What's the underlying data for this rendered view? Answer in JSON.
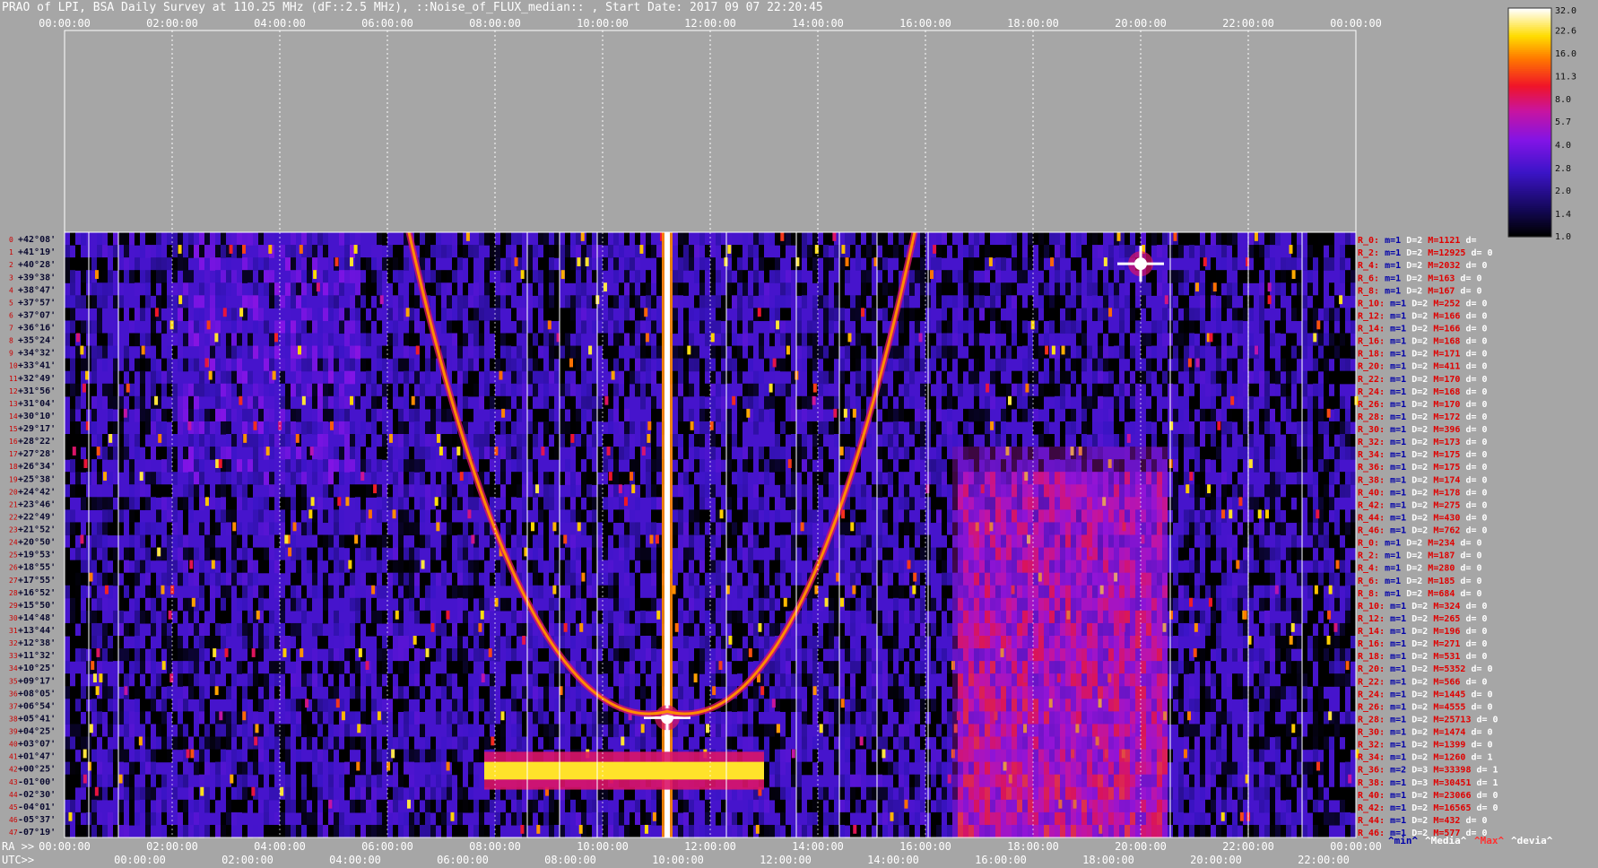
{
  "chart_data": {
    "type": "heatmap",
    "title": "PRAO of LPI, BSA Daily Survey at 110.25 MHz (dF::2.5 MHz), ::Noise_of_FLUX_median:: , Start Date: 2017 09 07 22:20:45",
    "top_axis_ticks": [
      "00:00:00",
      "02:00:00",
      "04:00:00",
      "06:00:00",
      "08:00:00",
      "10:00:00",
      "12:00:00",
      "14:00:00",
      "16:00:00",
      "18:00:00",
      "20:00:00",
      "22:00:00",
      "00:00:00"
    ],
    "ra_axis_label": "RA >>",
    "ra_ticks": [
      "00:00:00",
      "02:00:00",
      "04:00:00",
      "06:00:00",
      "08:00:00",
      "10:00:00",
      "12:00:00",
      "14:00:00",
      "16:00:00",
      "18:00:00",
      "20:00:00",
      "22:00:00",
      "00:00:00"
    ],
    "utc_axis_label": "UTC>>",
    "utc_ticks": [
      "00:00:00",
      "02:00:00",
      "04:00:00",
      "06:00:00",
      "08:00:00",
      "10:00:00",
      "12:00:00",
      "14:00:00",
      "16:00:00",
      "18:00:00",
      "20:00:00",
      "22:00:00"
    ],
    "colorbar": {
      "ticks": [
        "32.0",
        "22.6",
        "16.0",
        "11.3",
        "8.0",
        "5.7",
        "4.0",
        "2.8",
        "2.0",
        "1.4",
        "1.0"
      ],
      "scale": "log",
      "range": [
        1.0,
        32.0
      ]
    },
    "declinations": [
      "+42°08'",
      "+41°19'",
      "+40°28'",
      "+39°38'",
      "+38°47'",
      "+37°57'",
      "+37°07'",
      "+36°16'",
      "+35°24'",
      "+34°32'",
      "+33°41'",
      "+32°49'",
      "+31°56'",
      "+31°04'",
      "+30°10'",
      "+29°17'",
      "+28°22'",
      "+27°28'",
      "+26°34'",
      "+25°38'",
      "+24°42'",
      "+23°46'",
      "+22°49'",
      "+21°52'",
      "+20°50'",
      "+19°53'",
      "+18°55'",
      "+17°55'",
      "+16°52'",
      "+15°50'",
      "+14°48'",
      "+13°44'",
      "+12°38'",
      "+11°32'",
      "+10°25'",
      "+09°17'",
      "+08°05'",
      "+06°54'",
      "+05°41'",
      "+04°25'",
      "+03°07'",
      "+01°47'",
      "+00°25'",
      "-01°00'",
      "-02°30'",
      "-04°01'",
      "-05°37'",
      "-07°19'"
    ],
    "row_stats": [
      {
        "r": "R_0:",
        "m": "m=1",
        "d": "D=2",
        "mx": "M=1121",
        "dv": "d="
      },
      {
        "r": "R_2:",
        "m": "m=1",
        "d": "D=2",
        "mx": "M=12925",
        "dv": "d= 0"
      },
      {
        "r": "R_4:",
        "m": "m=1",
        "d": "D=2",
        "mx": "M=2032",
        "dv": "d= 0"
      },
      {
        "r": "R_6:",
        "m": "m=1",
        "d": "D=2",
        "mx": "M=163",
        "dv": "d= 0"
      },
      {
        "r": "R_8:",
        "m": "m=1",
        "d": "D=2",
        "mx": "M=167",
        "dv": "d= 0"
      },
      {
        "r": "R_10:",
        "m": "m=1",
        "d": "D=2",
        "mx": "M=252",
        "dv": "d= 0"
      },
      {
        "r": "R_12:",
        "m": "m=1",
        "d": "D=2",
        "mx": "M=166",
        "dv": "d= 0"
      },
      {
        "r": "R_14:",
        "m": "m=1",
        "d": "D=2",
        "mx": "M=166",
        "dv": "d= 0"
      },
      {
        "r": "R_16:",
        "m": "m=1",
        "d": "D=2",
        "mx": "M=168",
        "dv": "d= 0"
      },
      {
        "r": "R_18:",
        "m": "m=1",
        "d": "D=2",
        "mx": "M=171",
        "dv": "d= 0"
      },
      {
        "r": "R_20:",
        "m": "m=1",
        "d": "D=2",
        "mx": "M=411",
        "dv": "d= 0"
      },
      {
        "r": "R_22:",
        "m": "m=1",
        "d": "D=2",
        "mx": "M=170",
        "dv": "d= 0"
      },
      {
        "r": "R_24:",
        "m": "m=1",
        "d": "D=2",
        "mx": "M=168",
        "dv": "d= 0"
      },
      {
        "r": "R_26:",
        "m": "m=1",
        "d": "D=2",
        "mx": "M=170",
        "dv": "d= 0"
      },
      {
        "r": "R_28:",
        "m": "m=1",
        "d": "D=2",
        "mx": "M=172",
        "dv": "d= 0"
      },
      {
        "r": "R_30:",
        "m": "m=1",
        "d": "D=2",
        "mx": "M=396",
        "dv": "d= 0"
      },
      {
        "r": "R_32:",
        "m": "m=1",
        "d": "D=2",
        "mx": "M=173",
        "dv": "d= 0"
      },
      {
        "r": "R_34:",
        "m": "m=1",
        "d": "D=2",
        "mx": "M=175",
        "dv": "d= 0"
      },
      {
        "r": "R_36:",
        "m": "m=1",
        "d": "D=2",
        "mx": "M=175",
        "dv": "d= 0"
      },
      {
        "r": "R_38:",
        "m": "m=1",
        "d": "D=2",
        "mx": "M=174",
        "dv": "d= 0"
      },
      {
        "r": "R_40:",
        "m": "m=1",
        "d": "D=2",
        "mx": "M=178",
        "dv": "d= 0"
      },
      {
        "r": "R_42:",
        "m": "m=1",
        "d": "D=2",
        "mx": "M=275",
        "dv": "d= 0"
      },
      {
        "r": "R_44:",
        "m": "m=1",
        "d": "D=2",
        "mx": "M=430",
        "dv": "d= 0"
      },
      {
        "r": "R_46:",
        "m": "m=1",
        "d": "D=2",
        "mx": "M=762",
        "dv": "d= 0"
      },
      {
        "r": "R_0:",
        "m": "m=1",
        "d": "D=2",
        "mx": "M=234",
        "dv": "d= 0"
      },
      {
        "r": "R_2:",
        "m": "m=1",
        "d": "D=2",
        "mx": "M=187",
        "dv": "d= 0"
      },
      {
        "r": "R_4:",
        "m": "m=1",
        "d": "D=2",
        "mx": "M=280",
        "dv": "d= 0"
      },
      {
        "r": "R_6:",
        "m": "m=1",
        "d": "D=2",
        "mx": "M=185",
        "dv": "d= 0"
      },
      {
        "r": "R_8:",
        "m": "m=1",
        "d": "D=2",
        "mx": "M=684",
        "dv": "d= 0"
      },
      {
        "r": "R_10:",
        "m": "m=1",
        "d": "D=2",
        "mx": "M=324",
        "dv": "d= 0"
      },
      {
        "r": "R_12:",
        "m": "m=1",
        "d": "D=2",
        "mx": "M=265",
        "dv": "d= 0"
      },
      {
        "r": "R_14:",
        "m": "m=1",
        "d": "D=2",
        "mx": "M=196",
        "dv": "d= 0"
      },
      {
        "r": "R_16:",
        "m": "m=1",
        "d": "D=2",
        "mx": "M=271",
        "dv": "d= 0"
      },
      {
        "r": "R_18:",
        "m": "m=1",
        "d": "D=2",
        "mx": "M=531",
        "dv": "d= 0"
      },
      {
        "r": "R_20:",
        "m": "m=1",
        "d": "D=2",
        "mx": "M=5352",
        "dv": "d= 0"
      },
      {
        "r": "R_22:",
        "m": "m=1",
        "d": "D=2",
        "mx": "M=566",
        "dv": "d= 0"
      },
      {
        "r": "R_24:",
        "m": "m=1",
        "d": "D=2",
        "mx": "M=1445",
        "dv": "d= 0"
      },
      {
        "r": "R_26:",
        "m": "m=1",
        "d": "D=2",
        "mx": "M=4555",
        "dv": "d= 0"
      },
      {
        "r": "R_28:",
        "m": "m=1",
        "d": "D=2",
        "mx": "M=25713",
        "dv": "d= 0"
      },
      {
        "r": "R_30:",
        "m": "m=1",
        "d": "D=2",
        "mx": "M=1474",
        "dv": "d= 0"
      },
      {
        "r": "R_32:",
        "m": "m=1",
        "d": "D=2",
        "mx": "M=1399",
        "dv": "d= 0"
      },
      {
        "r": "R_34:",
        "m": "m=1",
        "d": "D=2",
        "mx": "M=1260",
        "dv": "d= 1"
      },
      {
        "r": "R_36:",
        "m": "m=2",
        "d": "D=3",
        "mx": "M=33398",
        "dv": "d= 1"
      },
      {
        "r": "R_38:",
        "m": "m=1",
        "d": "D=3",
        "mx": "M=30451",
        "dv": "d= 1"
      },
      {
        "r": "R_40:",
        "m": "m=1",
        "d": "D=2",
        "mx": "M=23066",
        "dv": "d= 0"
      },
      {
        "r": "R_42:",
        "m": "m=1",
        "d": "D=2",
        "mx": "M=16565",
        "dv": "d= 0"
      },
      {
        "r": "R_44:",
        "m": "m=1",
        "d": "D=2",
        "mx": "M=432",
        "dv": "d= 0"
      },
      {
        "r": "R_46:",
        "m": "m=1",
        "d": "D=2",
        "mx": "M=577",
        "dv": "d= 0"
      }
    ],
    "legend": [
      "^min^",
      "^Media^",
      "^Max^",
      "^devia^"
    ],
    "legend_colors": [
      "#0000aa",
      "#ffffff",
      "#ff3030",
      "#ffffff"
    ],
    "stat_colors": {
      "r": "#e00000",
      "m": "#0000aa",
      "d": "#ffffff",
      "mx": "#e00000",
      "dv": "#ffffff"
    },
    "index_colors": [
      "#cc0000"
    ],
    "features": [
      {
        "kind": "vertical_band",
        "ra_hours": 11.2,
        "dec_range": [
          "+42°08'",
          "-07°19'"
        ],
        "value": 32
      },
      {
        "kind": "horizontal_band",
        "ra_range_hours": [
          7.8,
          13.0
        ],
        "dec": "+00°25'",
        "value": 22.6
      },
      {
        "kind": "point",
        "ra_hours": 20.0,
        "dec": "+40°28'",
        "value": 32
      },
      {
        "kind": "point",
        "ra_hours": 11.2,
        "dec": "+05°41'",
        "value": 32
      },
      {
        "kind": "curve",
        "from_ra_hours": 6.4,
        "to_ra_hours": 15.8,
        "vertex_ra_hours": 11.2,
        "vertex_dec": "+05°41'",
        "value": 16
      },
      {
        "kind": "diffuse",
        "ra_range_hours": [
          16.5,
          20.5
        ],
        "dec_range": [
          "+27°28'",
          "-07°19'"
        ],
        "value": 5.7
      }
    ]
  }
}
